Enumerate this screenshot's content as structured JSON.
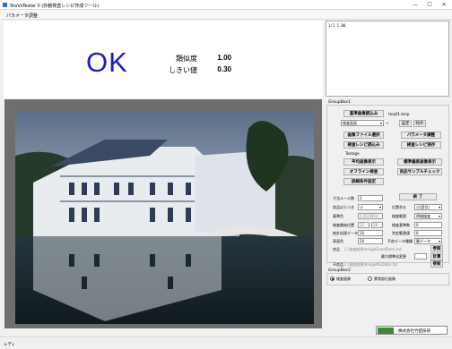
{
  "window": {
    "title": "StaVsTester II (外観検査レシピ作成ツール)",
    "min": "—",
    "max": "☐",
    "close": "✕"
  },
  "menu": {
    "item": "パラメータ調整"
  },
  "result": {
    "verdict": "OK",
    "similarity_label": "類似度",
    "similarity_value": "1.00",
    "threshold_label": "しきい値",
    "threshold_value": "0.30"
  },
  "log": {
    "lines": [
      "1/1   1.00"
    ]
  },
  "group1": {
    "title": "GroupBox1",
    "load_ref": "基準画像読込み",
    "tmp_file": "tmp01.bmp",
    "ref_select": "検査画面",
    "ref_arrow": "→",
    "set": "設定",
    "del": "除外",
    "load_img_file": "画像ファイル選択",
    "param_adjust": "パラメータ調整",
    "load_recipe": "検査レシピ読込み",
    "save_recipe": "検査レシピ保存",
    "textage": "Textage",
    "avg_img": "平均画像表示",
    "std_img": "標準偏差画像表示",
    "offline": "オフライン検査",
    "sample_check": "良品サンプルチェック",
    "detail_settings": "詳細条件設定"
  },
  "form": {
    "dilate_label": "寸法ルール数",
    "dilate_value": "2",
    "finish": "終 了",
    "pos_label": "良品ばらつき",
    "pos_value": "小",
    "filter_label": "位置合せ",
    "filter_value": "小(変位)",
    "base_label": "基準色",
    "base_value": "0.45;4853",
    "test_range_label": "検査範囲",
    "test_range_value": "明暗検査",
    "start_label": "検査開始位置",
    "start_x": "17",
    "start_y": "28",
    "check_label": "検査基準数",
    "check_value": "0",
    "stat_label": "統計処理データ数",
    "stat_value": "10",
    "judge_label": "判定範囲値",
    "judge_value": "0",
    "surface_label": "表面色",
    "surface_value": "50",
    "lowdata_label": "不良データ種類",
    "lowdata_value": "算データ",
    "good_label": "良品",
    "good_path": "C:\\検査結果\\ImageGoodData\\.txt",
    "ref_btn": "参照",
    "maxchange_label": "最大標準化変更",
    "calc_btn": "計算",
    "bad_label": "不良品",
    "bad_path": "C:\\検査結果\\ImageNGData\\.txt",
    "ref_btn2": "参照"
  },
  "group2": {
    "title": "GroupBox2",
    "opt1": "検査画像",
    "opt2": "異常部位画像"
  },
  "brand": {
    "name": "株式会社竹田技研"
  },
  "status": {
    "text": "レディ"
  }
}
